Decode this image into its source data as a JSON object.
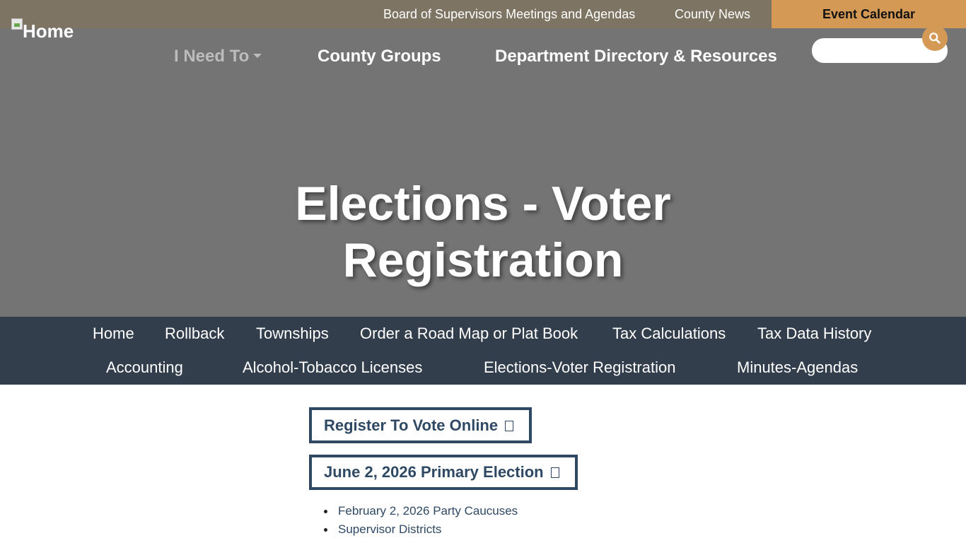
{
  "topbar": {
    "links": [
      {
        "label": "Board of Supervisors Meetings and Agendas"
      },
      {
        "label": "County News"
      },
      {
        "label": "Event Calendar"
      }
    ]
  },
  "logo": {
    "alt": "Home"
  },
  "main_nav": {
    "items": [
      {
        "label": "I Need To"
      },
      {
        "label": "County Groups"
      },
      {
        "label": "Department Directory & Resources"
      }
    ]
  },
  "search": {
    "value": "",
    "placeholder": "",
    "icon": "search-icon"
  },
  "hero": {
    "title": "Elections - Voter Registration"
  },
  "sub_nav": {
    "items": [
      {
        "label": "Home"
      },
      {
        "label": "Rollback"
      },
      {
        "label": "Townships"
      },
      {
        "label": "Order a Road Map or Plat Book"
      },
      {
        "label": "Tax Calculations"
      },
      {
        "label": "Tax Data History"
      },
      {
        "label": "Accounting"
      },
      {
        "label": "Alcohol-Tobacco Licenses"
      },
      {
        "label": "Elections-Voter Registration"
      },
      {
        "label": "Minutes-Agendas"
      }
    ]
  },
  "content": {
    "buttons": [
      {
        "label": "Register To Vote Online",
        "icon": "external-link-icon"
      },
      {
        "label": "June 2, 2026 Primary Election",
        "icon": "external-link-icon"
      }
    ],
    "links": [
      {
        "label": "February 2, 2026 Party Caucuses"
      },
      {
        "label": "Supervisor Districts"
      }
    ]
  },
  "colors": {
    "topbar": "#7e7463",
    "hero": "#747474",
    "accent": "#d49a55",
    "subnav": "#333e4c",
    "link": "#2f4964"
  }
}
